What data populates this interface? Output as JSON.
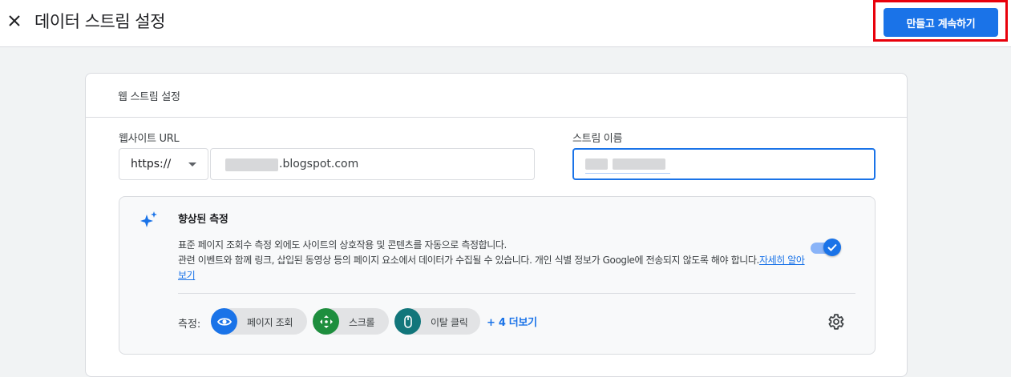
{
  "header": {
    "title": "데이터 스트림 설정",
    "create_button": "만들고 계속하기"
  },
  "card": {
    "heading": "웹 스트림 설정",
    "website_url_label": "웹사이트 URL",
    "protocol_value": "https://",
    "url_value": ".blogspot.com",
    "stream_name_label": "스트림 이름"
  },
  "enhanced": {
    "title": "향상된 측정",
    "description_line1": "표준 페이지 조회수 측정 외에도 사이트의 상호작용 및 콘텐츠를 자동으로 측정합니다.",
    "description_line2": "관련 이벤트와 함께 링크, 삽입된 동영상 등의 페이지 요소에서 데이터가 수집될 수 있습니다. 개인 식별 정보가 Google에 전송되지 않도록 해야 합니다.",
    "learn_more": "자세히 알아보기",
    "toggle_on": true,
    "measurement_label": "측정:",
    "chips": [
      {
        "label": "페이지 조회",
        "icon": "eye-icon",
        "color": "#1a73e8"
      },
      {
        "label": "스크롤",
        "icon": "scroll-arrows-icon",
        "color": "#1e8e3e"
      },
      {
        "label": "이탈 클릭",
        "icon": "mouse-icon",
        "color": "#12767b"
      }
    ],
    "more_link": "+ 4 더보기"
  },
  "colors": {
    "accent": "#1a73e8",
    "highlight_border": "#e8000b"
  }
}
